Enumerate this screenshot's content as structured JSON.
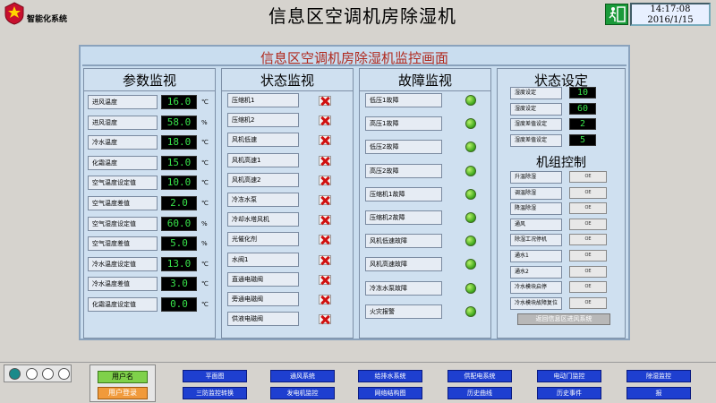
{
  "header": {
    "system_name": "智能化系统",
    "page_title": "信息区空调机房除湿机",
    "clock_time": "14:17:08",
    "clock_date": "2016/1/15"
  },
  "main": {
    "title": "信息区空调机房除湿机监控画面",
    "params": {
      "title": "参数监视",
      "items": [
        {
          "label": "进风温度",
          "value": "16.0",
          "unit": "℃"
        },
        {
          "label": "进风湿度",
          "value": "58.0",
          "unit": "%"
        },
        {
          "label": "冷水温度",
          "value": "18.0",
          "unit": "℃"
        },
        {
          "label": "化霜温度",
          "value": "15.0",
          "unit": "℃"
        },
        {
          "label": "空气温度设定值",
          "value": "10.0",
          "unit": "℃"
        },
        {
          "label": "空气温度差值",
          "value": "2.0",
          "unit": "℃"
        },
        {
          "label": "空气湿度设定值",
          "value": "60.0",
          "unit": "%"
        },
        {
          "label": "空气湿度差值",
          "value": "5.0",
          "unit": "%"
        },
        {
          "label": "冷水温度设定值",
          "value": "13.0",
          "unit": "℃"
        },
        {
          "label": "冷水温度差值",
          "value": "3.0",
          "unit": "℃"
        },
        {
          "label": "化霜温度设定值",
          "value": "0.0",
          "unit": "℃"
        }
      ]
    },
    "status": {
      "title": "状态监视",
      "items": [
        "压缩机1",
        "压缩机2",
        "风机低速",
        "风机高速1",
        "风机高速2",
        "冷冻水泵",
        "冷却水塔风机",
        "光催化剂",
        "水阀1",
        "直通电磁阀",
        "旁通电磁阀",
        "供液电磁阀"
      ]
    },
    "faults": {
      "title": "故障监视",
      "items": [
        "低压1故障",
        "高压1故障",
        "低压2故障",
        "高压2故障",
        "压缩机1故障",
        "压缩机2故障",
        "风机低速故障",
        "风机高速故障",
        "冷冻水泵故障",
        "火灾报警"
      ]
    },
    "settings": {
      "title": "状态设定",
      "items": [
        {
          "label": "湿度设定",
          "value": "10"
        },
        {
          "label": "湿度设定",
          "value": "60"
        },
        {
          "label": "湿度差值设定",
          "value": "2"
        },
        {
          "label": "湿度差值设定",
          "value": "5"
        }
      ]
    },
    "control": {
      "title": "机组控制",
      "items": [
        {
          "label": "升温除湿",
          "btn": "OE"
        },
        {
          "label": "调温除湿",
          "btn": "OE"
        },
        {
          "label": "降温除湿",
          "btn": "OE"
        },
        {
          "label": "通风",
          "btn": "OE"
        },
        {
          "label": "除湿工况停机",
          "btn": "OE"
        },
        {
          "label": "通水1",
          "btn": "OE"
        },
        {
          "label": "通水2",
          "btn": "OE"
        },
        {
          "label": "冷水模块启停",
          "btn": "OE"
        },
        {
          "label": "冷水模块故障复位",
          "btn": "OE"
        }
      ],
      "return_label": "返回信息区进风系统"
    }
  },
  "bottom": {
    "username": "用户名",
    "login": "用户登录",
    "nav_row1": [
      "平面图",
      "通风系统",
      "给排水系统",
      "供配电系统",
      "电动门监控",
      "除湿监控"
    ],
    "nav_row2": [
      "三防监控转换",
      "发电机监控",
      "网络结构图",
      "历史曲线",
      "历史事件",
      "报"
    ]
  }
}
